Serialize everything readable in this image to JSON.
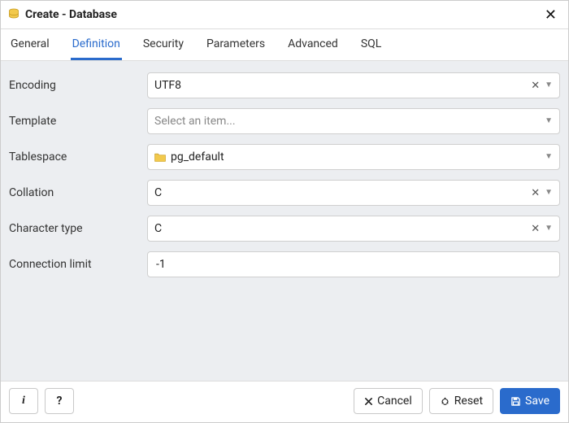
{
  "header": {
    "title": "Create - Database"
  },
  "tabs": [
    {
      "id": "general",
      "label": "General",
      "active": false
    },
    {
      "id": "definition",
      "label": "Definition",
      "active": true
    },
    {
      "id": "security",
      "label": "Security",
      "active": false
    },
    {
      "id": "parameters",
      "label": "Parameters",
      "active": false
    },
    {
      "id": "advanced",
      "label": "Advanced",
      "active": false
    },
    {
      "id": "sql",
      "label": "SQL",
      "active": false
    }
  ],
  "form": {
    "encoding": {
      "label": "Encoding",
      "value": "UTF8",
      "clearable": true
    },
    "template": {
      "label": "Template",
      "value": "",
      "placeholder": "Select an item...",
      "clearable": false
    },
    "tablespace": {
      "label": "Tablespace",
      "value": "pg_default",
      "clearable": false,
      "icon": "folder"
    },
    "collation": {
      "label": "Collation",
      "value": "C",
      "clearable": true
    },
    "character_type": {
      "label": "Character type",
      "value": "C",
      "clearable": true
    },
    "connection_limit": {
      "label": "Connection limit",
      "value": "-1"
    }
  },
  "footer": {
    "info_label": "i",
    "help_label": "?",
    "cancel_label": "Cancel",
    "reset_label": "Reset",
    "save_label": "Save"
  },
  "icons": {
    "close_glyph": "✕",
    "clear_glyph": "✕",
    "caret_glyph": "▼"
  }
}
